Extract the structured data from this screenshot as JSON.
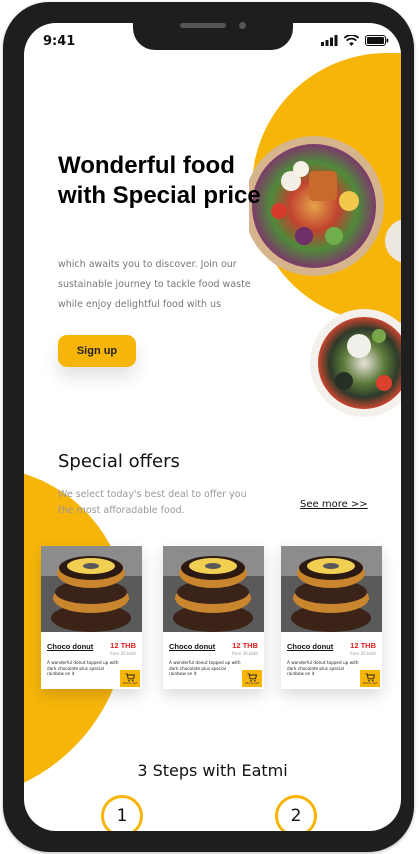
{
  "status_bar": {
    "time": "9:41"
  },
  "hero": {
    "title": "Wonderful food with Special price",
    "text": "which awaits you to discover. Join our sustainable journey to tackle food waste while enjoy delightful food with us",
    "signup_label": "Sign up"
  },
  "offers": {
    "title": "Special offers",
    "subtitle": "We select today's best deal to offer you the most afforadable food.",
    "see_more": "See more >>",
    "cards": [
      {
        "name": "Choco donut",
        "price": "12 THB",
        "original_price": "from 30 bath",
        "description": "A wonderful donut topped up with dark chocolate plus special rainbow on it",
        "add_label": "Add to cart"
      },
      {
        "name": "Choco donut",
        "price": "12 THB",
        "original_price": "from 30 bath",
        "description": "A wonderful donut topped up with dark chocolate plus special rainbow on it",
        "add_label": "Add to cart"
      },
      {
        "name": "Choco donut",
        "price": "12 THB",
        "original_price": "from 30 bath",
        "description": "A wonderful donut topped up with dark chocolate plus special rainbow on it",
        "add_label": "Add to cart"
      }
    ]
  },
  "steps": {
    "title": "3 Steps with Eatmi",
    "numbers": [
      "1",
      "2"
    ]
  },
  "colors": {
    "accent": "#f7b50a",
    "price": "#e02020",
    "frame": "#1e1e1e"
  },
  "icons": [
    "signal-icon",
    "wifi-icon",
    "battery-icon",
    "cart-icon"
  ]
}
